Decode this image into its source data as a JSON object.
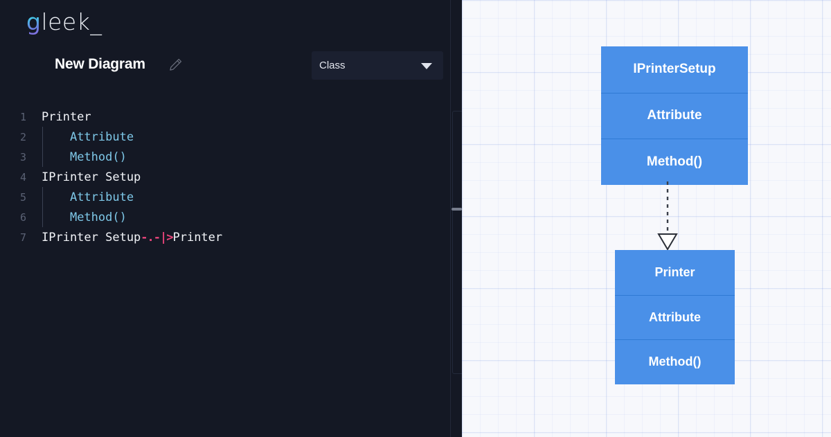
{
  "app": {
    "brand_prefix": "g",
    "brand_suffix": "leek_"
  },
  "header": {
    "diagram_title": "New Diagram",
    "edit_icon": "pencil-icon",
    "diagram_type": {
      "selected": "Class",
      "chevron_icon": "chevron-down-icon"
    }
  },
  "editor": {
    "lines": [
      {
        "number": "1",
        "indent": false,
        "text": "Printer",
        "kind": "class"
      },
      {
        "number": "2",
        "indent": true,
        "text": "Attribute",
        "kind": "member"
      },
      {
        "number": "3",
        "indent": true,
        "text": "Method()",
        "kind": "member"
      },
      {
        "number": "4",
        "indent": false,
        "text": "IPrinter Setup",
        "kind": "class"
      },
      {
        "number": "5",
        "indent": true,
        "text": "Attribute",
        "kind": "member"
      },
      {
        "number": "6",
        "indent": true,
        "text": "Method()",
        "kind": "member"
      },
      {
        "number": "7",
        "indent": false,
        "text": "IPrinter Setup",
        "kind": "relation",
        "relation_operator": "-.-|>",
        "relation_target": "Printer"
      }
    ],
    "colors": {
      "background": "#141824",
      "class_text": "#f2f4f8",
      "member_text": "#7ec8e8",
      "line_number": "#5b6275",
      "relation_operator": "#e8447a"
    }
  },
  "splitter": {
    "handle_icon": "drag-handle-icon"
  },
  "canvas": {
    "background": "#f7f8fc",
    "grid": "on",
    "classes": [
      {
        "id": "IPrinterSetup",
        "name": "IPrinterSetup",
        "attributes": "Attribute",
        "methods": "Method()",
        "fill": "#4a90e8"
      },
      {
        "id": "Printer",
        "name": "Printer",
        "attributes": "Attribute",
        "methods": "Method()",
        "fill": "#4a90e8"
      }
    ],
    "edges": [
      {
        "from": "IPrinterSetup",
        "to": "Printer",
        "type": "realization",
        "line_style": "dashed",
        "arrowhead": "hollow-triangle",
        "color": "#3a3f4a"
      }
    ]
  }
}
